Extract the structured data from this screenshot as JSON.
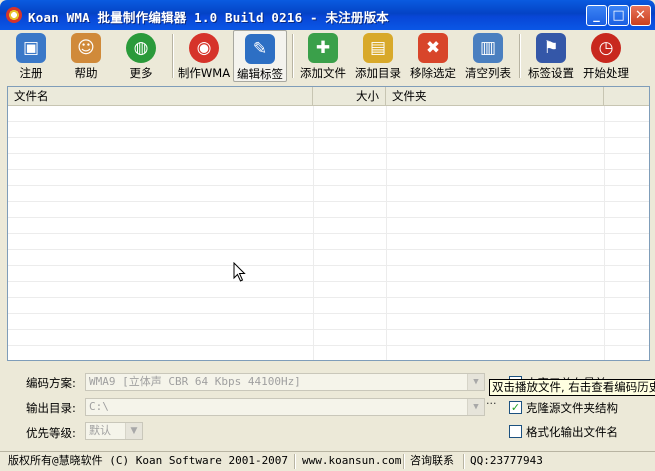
{
  "window": {
    "title": "Koan WMA 批量制作编辑器 1.0 Build 0216 - 未注册版本",
    "minimize": "_",
    "maximize": "□",
    "close": "✕"
  },
  "toolbar": {
    "items": [
      {
        "label": "注册",
        "icon": "computer-user-icon",
        "color": "#3a78c8",
        "glyph": "▣"
      },
      {
        "label": "帮助",
        "icon": "person-help-icon",
        "color": "#d08a3a",
        "glyph": "☺"
      },
      {
        "label": "更多",
        "icon": "globe-icon",
        "color": "#2a9a3a",
        "glyph": "◍"
      },
      {
        "label": "制作WMA",
        "icon": "media-disc-icon",
        "color": "#d6332a",
        "glyph": "◉"
      },
      {
        "label": "编辑标签",
        "icon": "edit-tag-icon",
        "color": "#2d6fc4",
        "glyph": "✎"
      },
      {
        "label": "添加文件",
        "icon": "add-file-icon",
        "color": "#3aa04a",
        "glyph": "✚"
      },
      {
        "label": "添加目录",
        "icon": "add-folder-icon",
        "color": "#d8a92a",
        "glyph": "▤"
      },
      {
        "label": "移除选定",
        "icon": "remove-icon",
        "color": "#d8452a",
        "glyph": "✖"
      },
      {
        "label": "清空列表",
        "icon": "trash-icon",
        "color": "#4a7fc0",
        "glyph": "▥"
      },
      {
        "label": "标签设置",
        "icon": "tag-settings-icon",
        "color": "#3457a8",
        "glyph": "⚑"
      },
      {
        "label": "开始处理",
        "icon": "clock-start-icon",
        "color": "#c8281e",
        "glyph": "◷"
      }
    ]
  },
  "list": {
    "columns": [
      "文件名",
      "大小",
      "文件夹"
    ]
  },
  "options": {
    "encoding_label": "编码方案:",
    "encoding_value": "WMA9 [立体声 CBR  64 Kbps 44100Hz]",
    "output_label": "输出目录:",
    "output_value": "C:\\",
    "output_browse": "···",
    "priority_label": "优先等级:",
    "priority_value": "默认",
    "checkbox_ontop": "本窗口总在最前",
    "checkbox_clone": "克隆源文件夹结构",
    "checkbox_format": "格式化输出文件名",
    "tooltip": "双击播放文件, 右击查看编码历史"
  },
  "status": {
    "copyright": "版权所有@慧晓软件 (C) Koan Software 2001-2007",
    "website": "www.koansun.com",
    "contact_label": "咨询联系",
    "qq": "QQ:23777943"
  }
}
